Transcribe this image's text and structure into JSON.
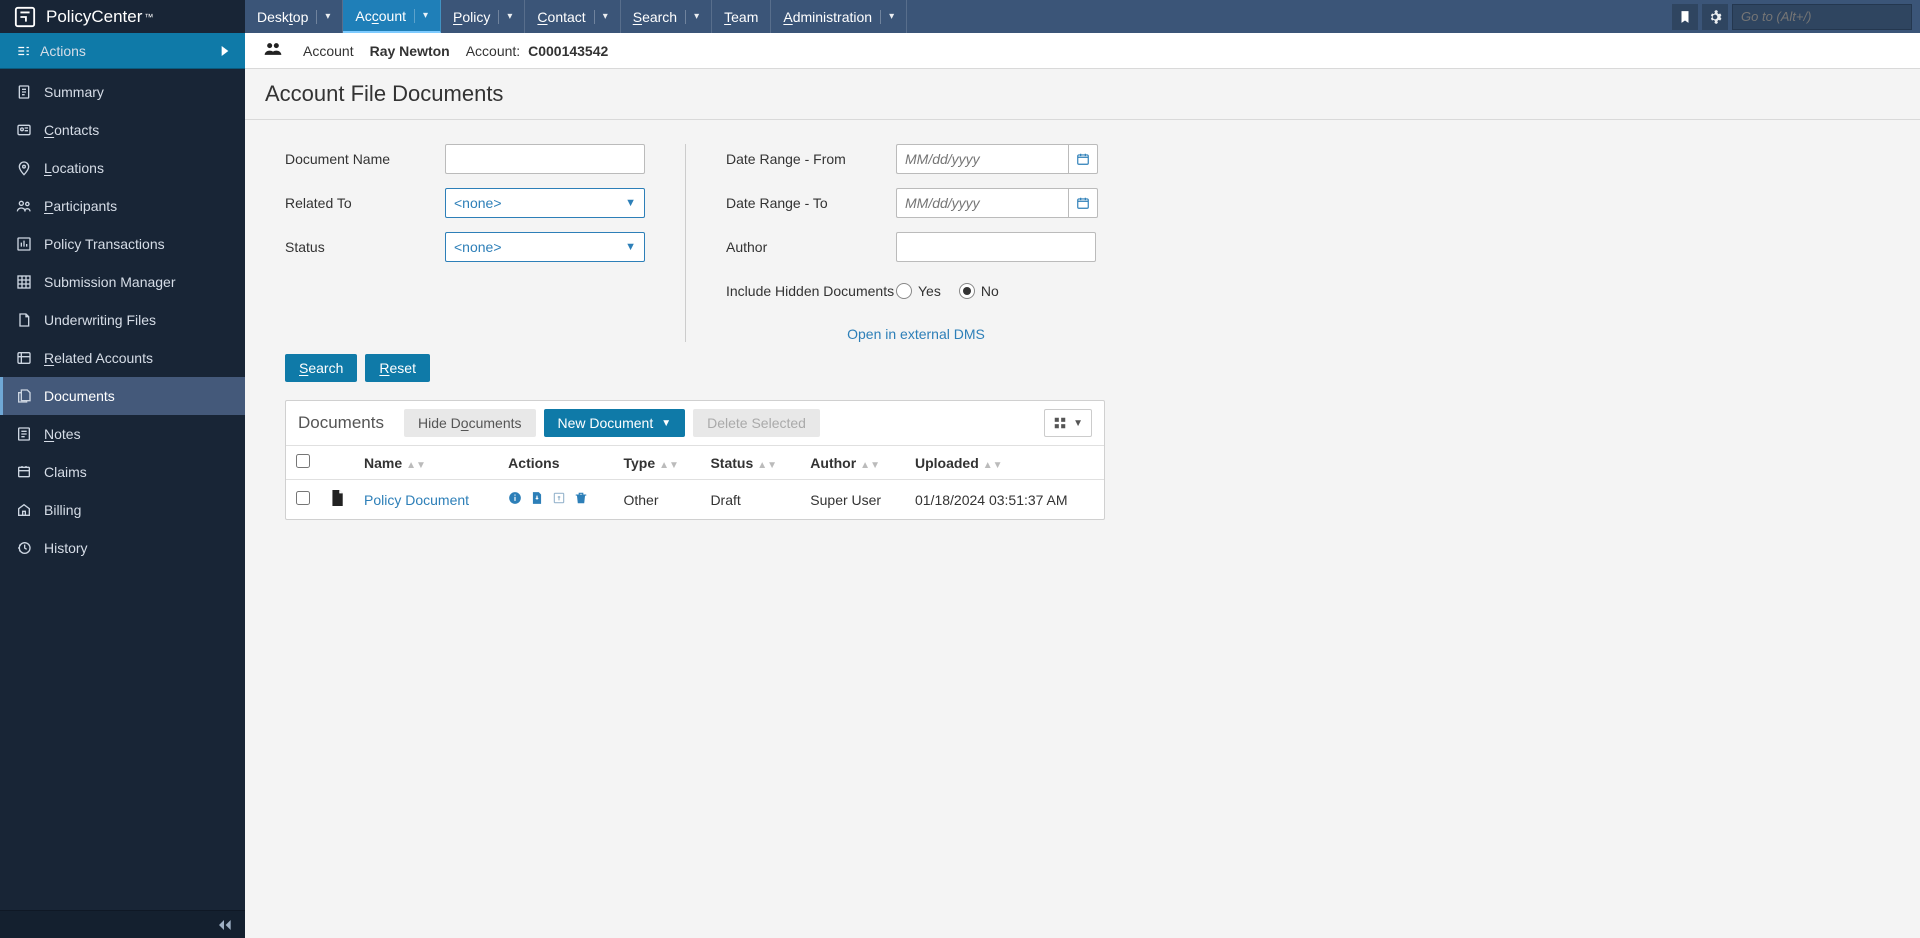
{
  "brand": {
    "name": "PolicyCenter",
    "tm": "™"
  },
  "topnav": [
    {
      "label": "Desktop",
      "ul": "t",
      "pre": "Desk",
      "post": "op",
      "dropdown": true,
      "active": false
    },
    {
      "label": "Account",
      "ul": "c",
      "pre": "Ac",
      "post": "ount",
      "dropdown": true,
      "active": true
    },
    {
      "label": "Policy",
      "ul": "P",
      "pre": "",
      "post": "olicy",
      "dropdown": true,
      "active": false
    },
    {
      "label": "Contact",
      "ul": "C",
      "pre": "",
      "post": "ontact",
      "dropdown": true,
      "active": false
    },
    {
      "label": "Search",
      "ul": "S",
      "pre": "",
      "post": "earch",
      "dropdown": true,
      "active": false
    },
    {
      "label": "Team",
      "ul": "T",
      "pre": "",
      "post": "eam",
      "dropdown": false,
      "active": false
    },
    {
      "label": "Administration",
      "ul": "A",
      "pre": "",
      "post": "dministration",
      "dropdown": true,
      "active": false
    }
  ],
  "goto_placeholder": "Go to (Alt+/)",
  "context": {
    "entity_label": "Account",
    "person_name": "Ray Newton",
    "account_label": "Account:",
    "account_number": "C000143542"
  },
  "actions_label": "Actions",
  "sidebar": [
    {
      "label": "Summary",
      "icon": "file",
      "ul_first": false
    },
    {
      "label": "Contacts",
      "icon": "id",
      "ul_first": true
    },
    {
      "label": "Locations",
      "icon": "pin",
      "ul_first": true
    },
    {
      "label": "Participants",
      "icon": "people",
      "ul_first": true
    },
    {
      "label": "Policy Transactions",
      "icon": "chart",
      "ul_first": false
    },
    {
      "label": "Submission Manager",
      "icon": "grid",
      "ul_first": false
    },
    {
      "label": "Underwriting Files",
      "icon": "doc",
      "ul_first": false
    },
    {
      "label": "Related Accounts",
      "icon": "link",
      "ul_first": true
    },
    {
      "label": "Documents",
      "icon": "docs",
      "ul_first": false,
      "active": true
    },
    {
      "label": "Notes",
      "icon": "note",
      "ul_first": true
    },
    {
      "label": "Claims",
      "icon": "claim",
      "ul_first": false
    },
    {
      "label": "Billing",
      "icon": "billing",
      "ul_first": false
    },
    {
      "label": "History",
      "icon": "history",
      "ul_first": false
    }
  ],
  "page_title": "Account File Documents",
  "search": {
    "doc_name_label": "Document Name",
    "doc_name_value": "",
    "related_to_label": "Related To",
    "related_to_value": "<none>",
    "status_label": "Status",
    "status_value": "<none>",
    "date_from_label": "Date Range - From",
    "date_from_placeholder": "MM/dd/yyyy",
    "date_to_label": "Date Range - To",
    "date_to_placeholder": "MM/dd/yyyy",
    "author_label": "Author",
    "author_value": "",
    "include_hidden_label": "Include Hidden Documents",
    "include_hidden_yes": "Yes",
    "include_hidden_no": "No",
    "external_dms_label": "Open in external DMS"
  },
  "buttons": {
    "search_pre": "",
    "search_ul": "S",
    "search_post": "earch",
    "reset_pre": "",
    "reset_ul": "R",
    "reset_post": "eset",
    "hide_pre": "Hide D",
    "hide_ul": "o",
    "hide_post": "cuments",
    "new_document": "New Document",
    "delete_selected": "Delete Selected"
  },
  "documents": {
    "section_title": "Documents",
    "columns": {
      "name": "Name",
      "actions": "Actions",
      "type": "Type",
      "status": "Status",
      "author": "Author",
      "uploaded": "Uploaded"
    },
    "rows": [
      {
        "name": "Policy Document",
        "type": "Other",
        "status": "Draft",
        "author": "Super User",
        "uploaded": "01/18/2024 03:51:37 AM"
      }
    ]
  }
}
